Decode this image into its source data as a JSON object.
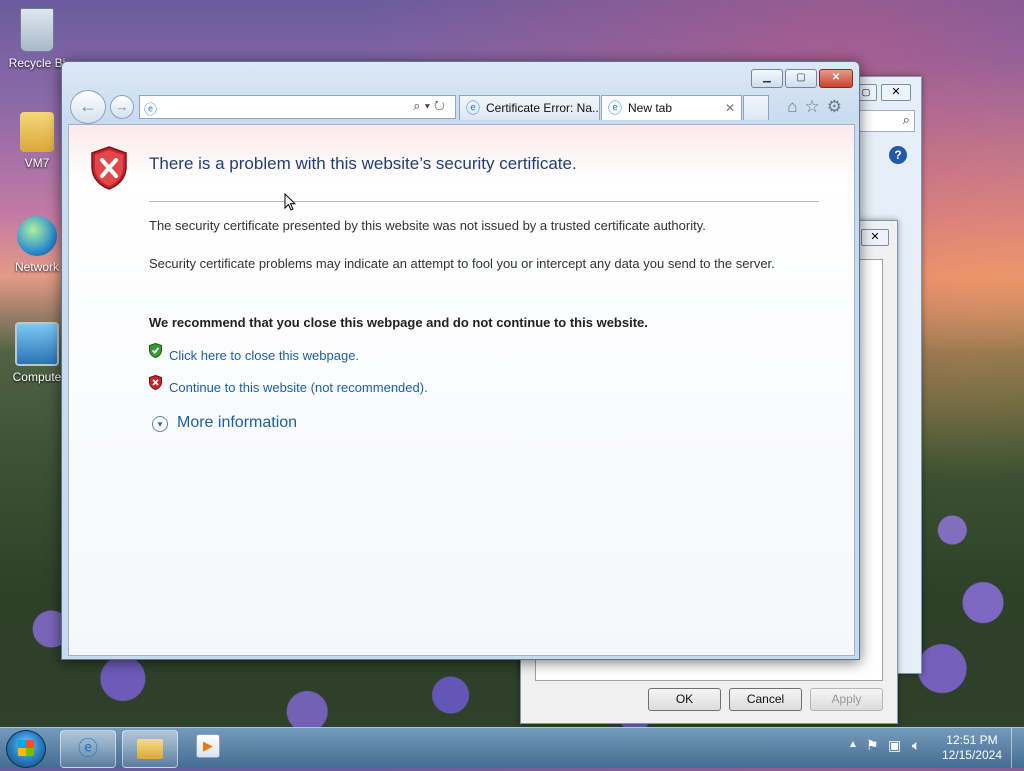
{
  "desktop": {
    "icons": [
      {
        "label": "Recycle Bin",
        "visible_label": "Recycle Bi"
      },
      {
        "label": "VM7"
      },
      {
        "label": "Network"
      },
      {
        "label": "Computer",
        "visible_label": "Compute"
      }
    ]
  },
  "browser": {
    "address_value": "",
    "tabs": [
      {
        "label": "Certificate Error: Na..."
      },
      {
        "label": "New tab"
      }
    ],
    "page": {
      "title": "There is a problem with this website’s security certificate.",
      "para1": "The security certificate presented by this website was not issued by a trusted certificate authority.",
      "para2": "Security certificate problems may indicate an attempt to fool you or intercept any data you send to the server.",
      "recommendation": "We recommend that you close this webpage and do not continue to this website.",
      "close_link": "Click here to close this webpage.",
      "continue_link": "Continue to this website (not recommended).",
      "more_info": "More information"
    }
  },
  "dialog": {
    "ok": "OK",
    "cancel": "Cancel",
    "apply": "Apply"
  },
  "taskbar": {
    "time": "12:51 PM",
    "date": "12/15/2024"
  },
  "colors": {
    "accent_title": "#1f3f78",
    "link": "#1a5fa8",
    "close_btn": "#c7452e"
  }
}
